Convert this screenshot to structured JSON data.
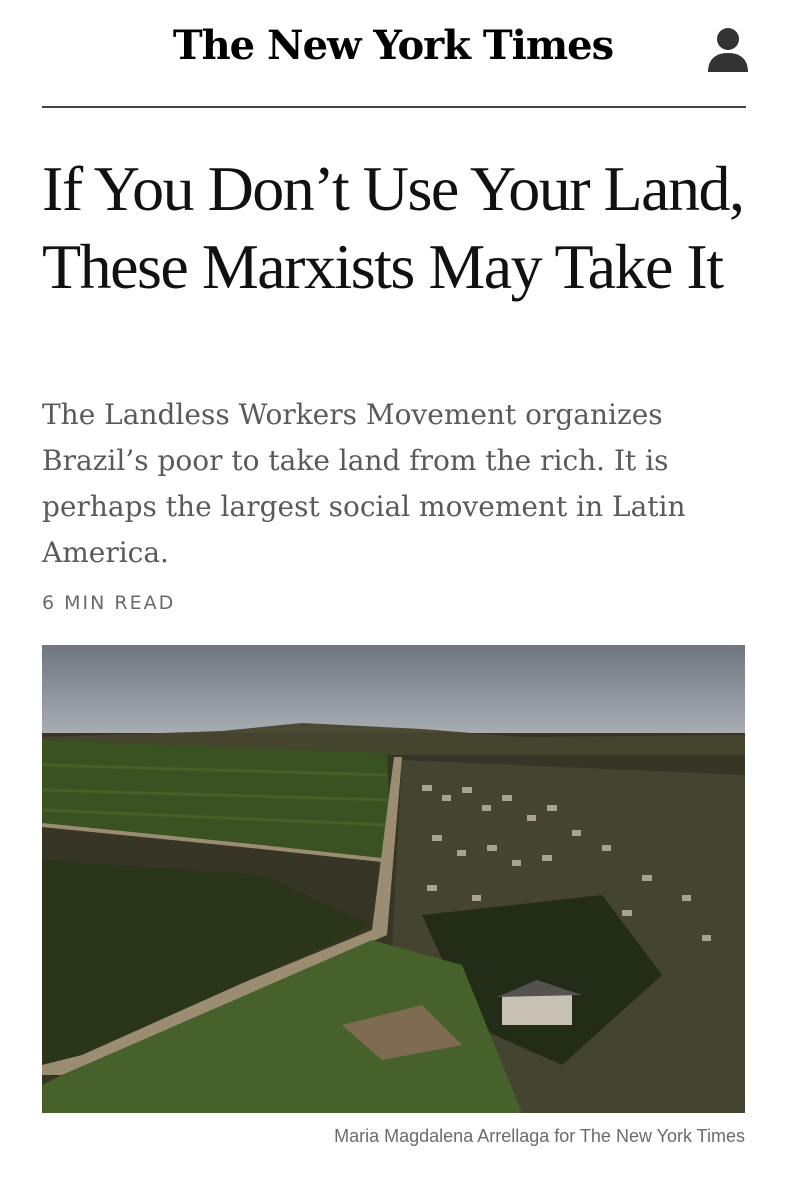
{
  "masthead": {
    "logo_text": "The New York Times",
    "account_icon": "user-account-icon"
  },
  "article": {
    "headline": "If You Don’t Use Your Land, These Marxists May Take It",
    "summary": "The Landless Workers Movement organizes Brazil’s poor to take land from the rich. It is perhaps the largest social movement in Latin America.",
    "read_time": "6 MIN READ",
    "photo_credit": "Maria Magdalena Arrellaga for The New York Times"
  },
  "colors": {
    "text": "#121212",
    "summary_text": "#5a5a5a",
    "meta_text": "#6b6b6b",
    "divider": "#444444"
  }
}
